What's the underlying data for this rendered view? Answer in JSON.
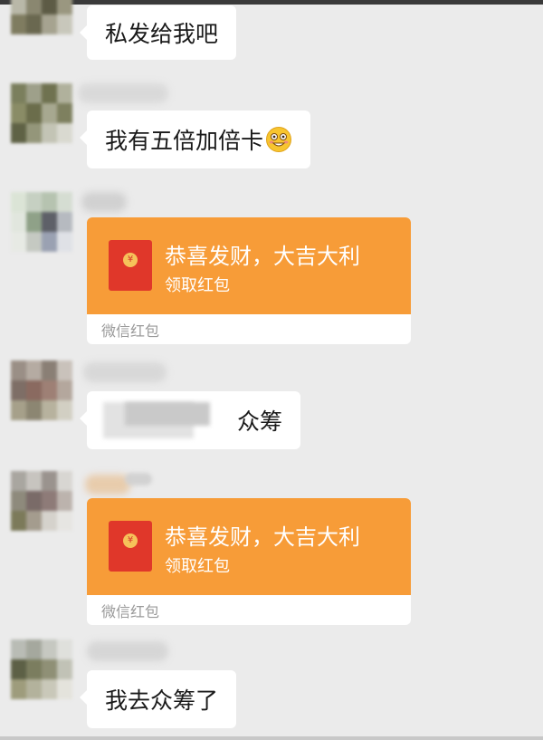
{
  "messages": [
    {
      "type": "text",
      "text": "私发给我吧"
    },
    {
      "type": "text",
      "text": "我有五倍加倍卡",
      "emoji": "grinning-face-emoji"
    },
    {
      "type": "red_packet",
      "title": "恭喜发财，大吉大利",
      "action": "领取红包",
      "footer": "微信红包"
    },
    {
      "type": "text",
      "text": "众筹"
    },
    {
      "type": "red_packet",
      "title": "恭喜发财，大吉大利",
      "action": "领取红包",
      "footer": "微信红包"
    },
    {
      "type": "text",
      "text": "我去众筹了"
    }
  ],
  "colors": {
    "background": "#ebebeb",
    "bubble": "#ffffff",
    "red_packet": "#f79c38",
    "red_packet_icon": "#e0372a"
  }
}
